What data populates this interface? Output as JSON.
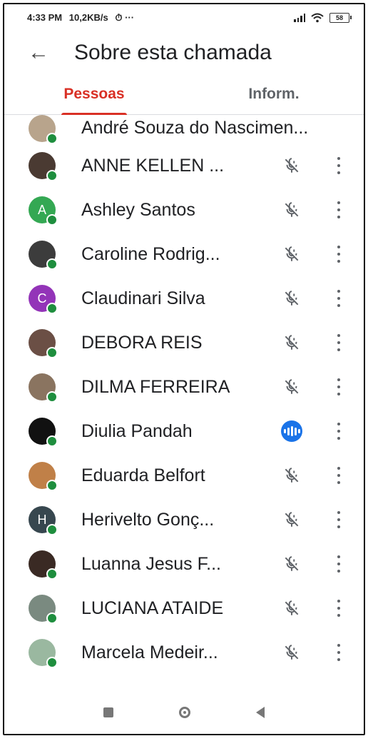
{
  "status_bar": {
    "time": "4:33 PM",
    "speed": "10,2KB/s",
    "extra": "⏱ ···",
    "battery": "58"
  },
  "app_bar": {
    "back_icon": "arrow-left-icon",
    "title": "Sobre esta chamada"
  },
  "tabs": [
    {
      "label": "Pessoas",
      "active": true
    },
    {
      "label": "Inform.",
      "active": false
    }
  ],
  "colors": {
    "accent": "#d93025",
    "online": "#1e8e3e",
    "speaking": "#1a73e8"
  },
  "participants": [
    {
      "name": "André Souza do Nascimen...",
      "avatar_letter": "",
      "avatar_color": "#b8a48c",
      "status": "none"
    },
    {
      "name": "ANNE KELLEN ...",
      "avatar_letter": "",
      "avatar_color": "#4a3a32",
      "status": "muted"
    },
    {
      "name": "Ashley Santos",
      "avatar_letter": "A",
      "avatar_color": "#34a853",
      "status": "muted"
    },
    {
      "name": "Caroline Rodrig...",
      "avatar_letter": "",
      "avatar_color": "#3c3c3c",
      "status": "muted"
    },
    {
      "name": "Claudinari Silva",
      "avatar_letter": "C",
      "avatar_color": "#9334b8",
      "status": "muted"
    },
    {
      "name": "DEBORA REIS",
      "avatar_letter": "",
      "avatar_color": "#6b4f45",
      "status": "muted"
    },
    {
      "name": "DILMA FERREIRA",
      "avatar_letter": "",
      "avatar_color": "#8a7460",
      "status": "muted"
    },
    {
      "name": "Diulia Pandah",
      "avatar_letter": "",
      "avatar_color": "#111111",
      "status": "speaking"
    },
    {
      "name": "Eduarda Belfort",
      "avatar_letter": "",
      "avatar_color": "#c08048",
      "status": "muted"
    },
    {
      "name": "Herivelto Gonç...",
      "avatar_letter": "H",
      "avatar_color": "#37474f",
      "status": "muted"
    },
    {
      "name": "Luanna Jesus F...",
      "avatar_letter": "",
      "avatar_color": "#3a2a24",
      "status": "muted"
    },
    {
      "name": "LUCIANA ATAIDE",
      "avatar_letter": "",
      "avatar_color": "#7a8a80",
      "status": "muted"
    },
    {
      "name": "Marcela Medeir...",
      "avatar_letter": "",
      "avatar_color": "#9ab8a0",
      "status": "muted"
    }
  ],
  "nav_bar": {
    "recents_icon": "square-icon",
    "home_icon": "circle-icon",
    "back_icon": "triangle-back-icon"
  }
}
